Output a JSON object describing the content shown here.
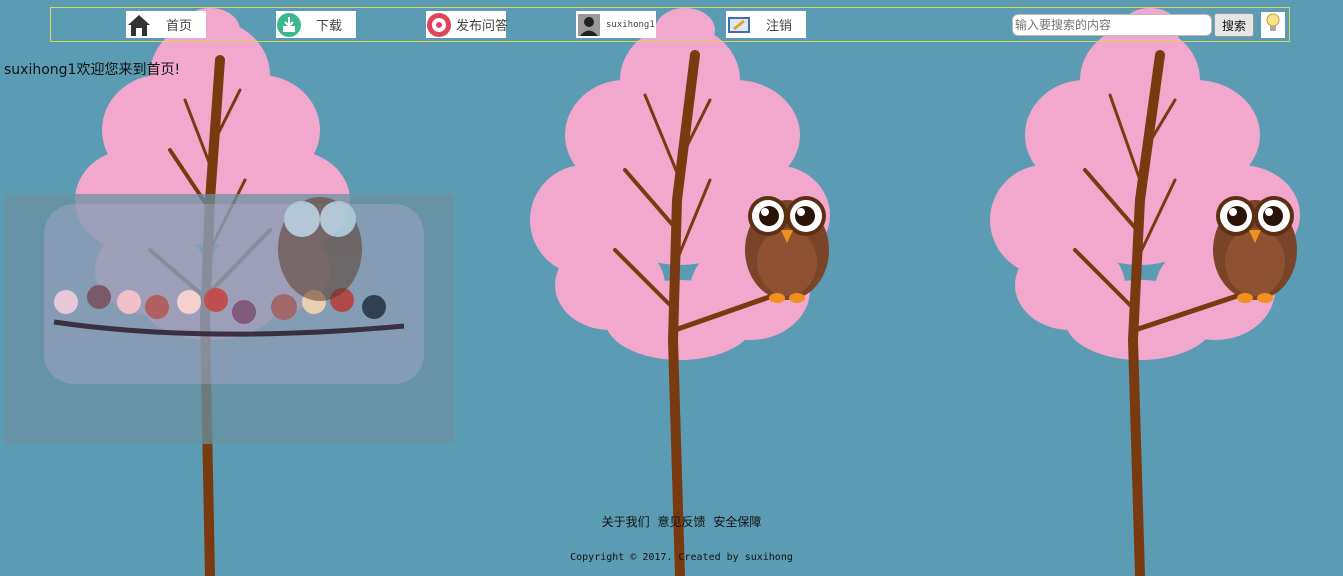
{
  "nav": {
    "items": [
      {
        "label": "首页",
        "icon": "home-icon"
      },
      {
        "label": "下载",
        "icon": "download-icon"
      },
      {
        "label": "发布问答",
        "icon": "qa-icon"
      },
      {
        "label": "suxihong1",
        "icon": "user-avatar-icon"
      },
      {
        "label": "注销",
        "icon": "logout-icon"
      }
    ],
    "search": {
      "placeholder": "输入要搜索的内容",
      "value": "",
      "button_label": "搜索"
    },
    "hint_icon": "lightbulb-icon"
  },
  "welcome_text": "suxihong1欢迎您来到首页!",
  "footer": {
    "links": [
      "关于我们",
      "意见反馈",
      "安全保障"
    ],
    "copyright": "Copyright © 2017. Created by suxihong"
  },
  "colors": {
    "background": "#5b9bb3",
    "blossom": "#f2a8cc",
    "trunk": "#7a3a10",
    "nav_border": "#d8d850",
    "owl_body": "#7a4428"
  }
}
